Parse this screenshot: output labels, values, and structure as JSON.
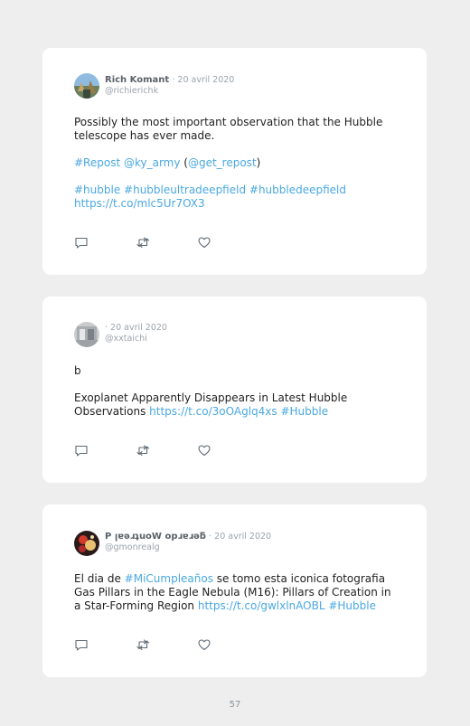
{
  "tweets": [
    {
      "display_name": "Rich Komant",
      "date": "· 20 avril 2020",
      "handle": "@richierichk",
      "paragraphs": [
        [
          {
            "text": "Possibly the most important observation that the Hubble telescope has ever made.",
            "link": false
          }
        ],
        [
          {
            "text": "#Repost @ky_army",
            "link": true
          },
          {
            "text": " (",
            "link": false
          },
          {
            "text": "@get_repost",
            "link": true
          },
          {
            "text": ")",
            "link": false
          }
        ],
        [
          {
            "text": "#hubble #hubbleultradeepfield #hubbledeepfield https://t.co/mlc5Ur7OX3",
            "link": true
          }
        ]
      ]
    },
    {
      "display_name": "",
      "date": "· 20 avril 2020",
      "handle": "@xxtaichi",
      "paragraphs": [
        [
          {
            "text": "b",
            "link": false
          }
        ],
        [
          {
            "text": "Exoplanet Apparently Disappears in Latest Hubble Observations ",
            "link": false
          },
          {
            "text": "https://t.co/3oOAglq4xs #Hubble",
            "link": true
          }
        ]
      ]
    },
    {
      "display_name": "P ןɐǝɹʇuoW opɹɐɹǝƃ",
      "date": "· 20 avril 2020",
      "handle": "@gmonrealg",
      "paragraphs": [
        [
          {
            "text": "El dia de ",
            "link": false
          },
          {
            "text": "#MiCumpleaños",
            "link": true
          },
          {
            "text": " se tomo esta iconica fotografia Gas Pillars in the Eagle Nebula (M16): Pillars of Creation in a Star-Forming Region ",
            "link": false
          },
          {
            "text": "https://t.co/gwlxlnAOBL #Hubble",
            "link": true
          }
        ]
      ]
    }
  ],
  "icons": {
    "reply": "reply-icon",
    "retweet": "retweet-icon",
    "like": "heart-icon"
  },
  "footer": {
    "page_number": "57"
  }
}
